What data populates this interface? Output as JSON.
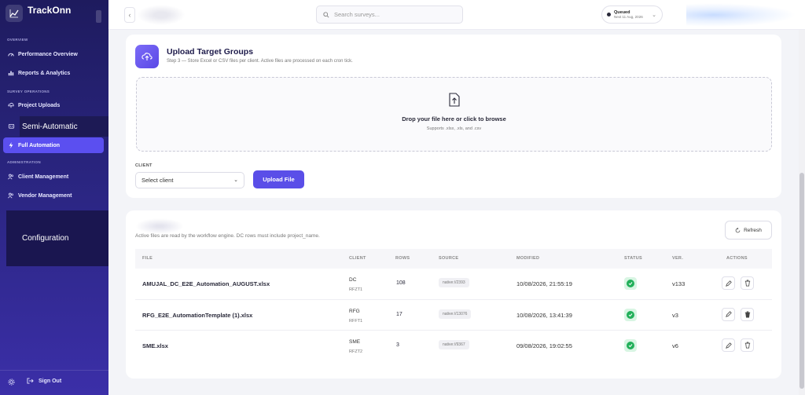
{
  "app": {
    "name": "TrackOnn"
  },
  "sidebar": {
    "sections": {
      "overview": "OVERVIEW",
      "survey_operations": "SURVEY OPERATIONS",
      "administration": "ADMINISTRATION"
    },
    "items": [
      {
        "label": "Performance Overview",
        "icon": "gauge-icon"
      },
      {
        "label": "Reports & Analytics",
        "icon": "bar-chart-icon"
      },
      {
        "label": "Project Uploads",
        "icon": "upload-icon"
      },
      {
        "label": "Semi-Automatic",
        "icon": "robot-icon"
      },
      {
        "label": "Full Automation",
        "icon": "lightning-icon",
        "active": true
      },
      {
        "label": "Client Management",
        "icon": "users-icon"
      },
      {
        "label": "Vendor Management",
        "icon": "users-icon"
      },
      {
        "label": "Configuration",
        "icon": "gear-icon"
      }
    ],
    "sign_out": "Sign Out"
  },
  "topbar": {
    "search_placeholder": "Search surveys...",
    "status": {
      "title": "Queued",
      "subtitle": "Next 11 Aug, 2026"
    }
  },
  "upload_card": {
    "title": "Upload Target Groups",
    "subtitle": "Step 3 — Store Excel or CSV files per client. Active files are processed on each cron tick.",
    "dropzone": {
      "title": "Drop your file here or click to browse",
      "subtitle": "Supports .xlsx, .xls, and .csv"
    },
    "client_label": "CLIENT",
    "client_select": "Select client",
    "upload_button": "Upload File"
  },
  "files_card": {
    "subtitle": "Active files are read by the workflow engine. DC rows must include project_name.",
    "refresh_button": "Refresh",
    "columns": [
      "FILE",
      "CLIENT",
      "ROWS",
      "SOURCE",
      "MODIFIED",
      "STATUS",
      "VER.",
      "ACTIONS"
    ],
    "rows": [
      {
        "file": "AMUJAL_DC_E2E_Automation_AUGUST.xlsx",
        "client": "DC",
        "client_code": "RFZT1",
        "rows": "108",
        "source": "native://2393",
        "modified": "10/08/2026, 21:55:19",
        "version": "v133"
      },
      {
        "file": "RFG_E2E_AutomationTemplate (1).xlsx",
        "client": "RFG",
        "client_code": "RFFT1",
        "rows": "17",
        "source": "native://13076",
        "modified": "10/08/2026, 13:41:39",
        "version": "v3"
      },
      {
        "file": "SME.xlsx",
        "client": "SME",
        "client_code": "RFZT2",
        "rows": "3",
        "source": "native://9367",
        "modified": "09/08/2026, 19:02:55",
        "version": "v6"
      }
    ]
  },
  "colors": {
    "accent": "#5a4ee8",
    "sidebar": "#2a2580",
    "success": "#22b05a"
  }
}
